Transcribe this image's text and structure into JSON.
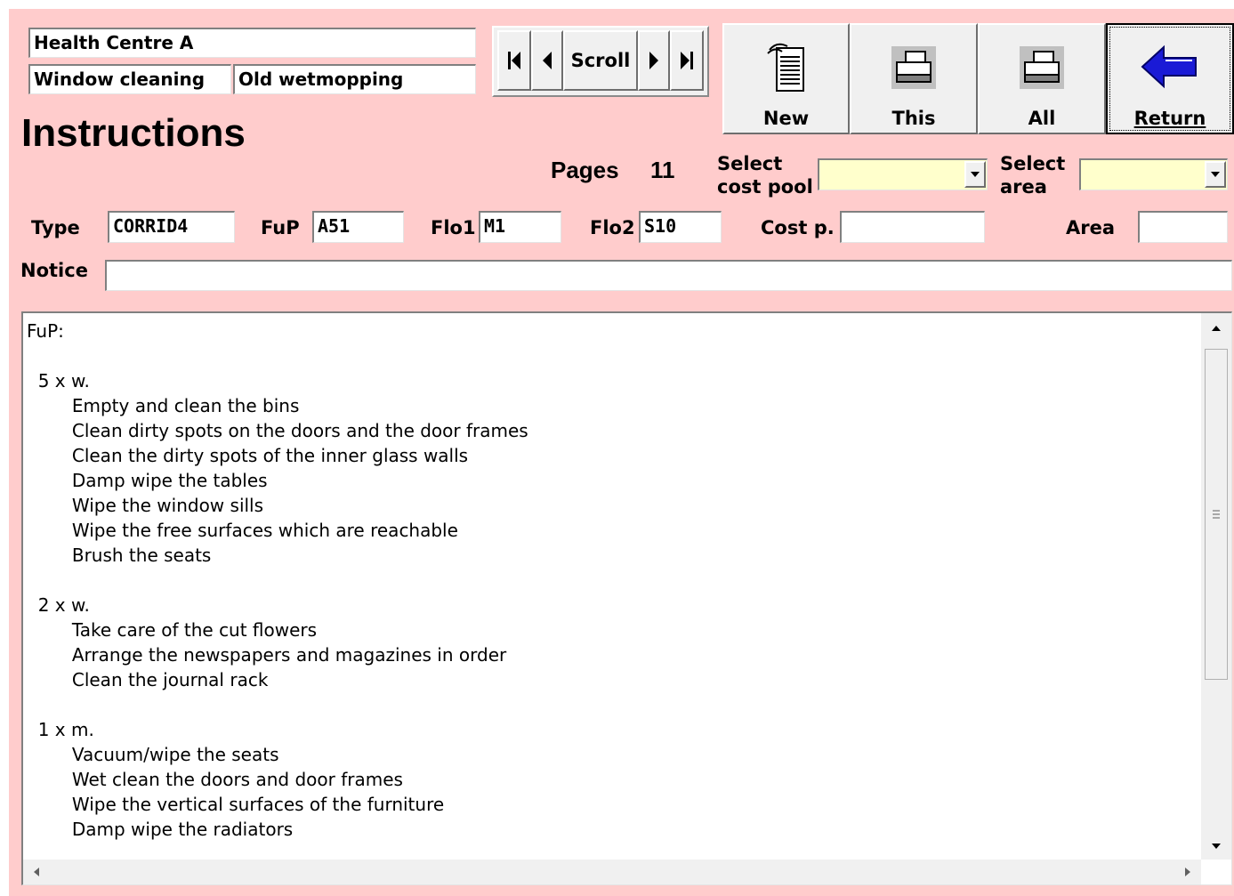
{
  "header": {
    "site_name": "Health Centre A",
    "work_type": "Window cleaning",
    "method": "Old wetmopping",
    "title": "Instructions"
  },
  "nav": {
    "scroll_label": "Scroll",
    "icons": [
      "first-record-icon",
      "prev-record-icon",
      "next-record-icon",
      "last-record-icon"
    ]
  },
  "toolbar": {
    "new_label": "New",
    "this_label": "This",
    "all_label": "All",
    "return_label": "Return",
    "colors": {
      "return_arrow": "#1a1ad6",
      "printer_bg": "#c0c0c0"
    }
  },
  "pages": {
    "label": "Pages",
    "count": "11"
  },
  "cost_pool": {
    "label": "Select\ncost pool",
    "value": ""
  },
  "area_select": {
    "label": "Select\narea",
    "value": ""
  },
  "fields": {
    "type_label": "Type",
    "type_value": "CORRID4",
    "fup_label": "FuP",
    "fup_value": "A51",
    "flo1_label": "Flo1",
    "flo1_value": "M1",
    "flo2_label": "Flo2",
    "flo2_value": "S10",
    "costp_label": "Cost p.",
    "costp_value": "",
    "area_label": "Area",
    "area_value": "",
    "notice_label": "Notice",
    "notice_value": ""
  },
  "instructions_text": [
    "FuP:",
    "",
    "  5 x w.",
    "        Empty and clean the bins",
    "        Clean dirty spots on the doors and the door frames",
    "        Clean the dirty spots of the inner glass walls",
    "        Damp wipe the tables",
    "        Wipe the window sills",
    "        Wipe the free surfaces which are reachable",
    "        Brush the seats",
    "",
    "  2 x w.",
    "        Take care of the cut flowers",
    "        Arrange the newspapers and magazines in order",
    "        Clean the journal rack",
    "",
    "  1 x m.",
    "        Vacuum/wipe the seats",
    "        Wet clean the doors and door frames",
    "        Wipe the vertical surfaces of the furniture",
    "        Damp wipe the radiators"
  ],
  "colors": {
    "background": "#ffcccc",
    "combo_bg": "#ffffcc"
  }
}
